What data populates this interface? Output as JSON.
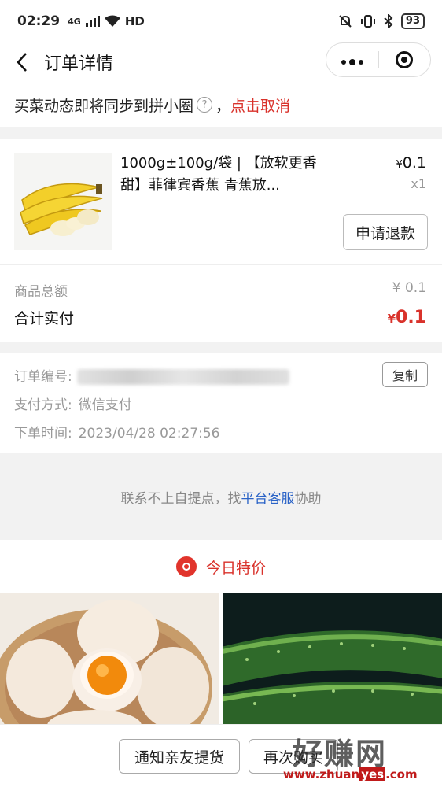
{
  "status_bar": {
    "time": "02:29",
    "network": "4G",
    "hd": "HD",
    "battery": "93"
  },
  "nav": {
    "title": "订单详情",
    "back_icon": "chevron-left-icon",
    "more_icon": "more-dots-icon",
    "close_icon": "target-close-icon"
  },
  "notice": {
    "text": "买菜动态即将同步到拼小圈",
    "comma": "，",
    "action": "点击取消"
  },
  "product": {
    "name": "1000g±100g/袋 | 【放软更香甜】菲律宾香蕉 青蕉放...",
    "price_symbol": "¥",
    "price": "0.1",
    "qty": "x1",
    "refund_label": "申请退款"
  },
  "summary": {
    "subtotal_label": "商品总额",
    "subtotal_value": "¥ 0.1",
    "total_label": "合计实付",
    "total_symbol": "¥",
    "total_value": "0.1"
  },
  "order_info": {
    "number_label": "订单编号:",
    "copy_label": "复制",
    "payment_label": "支付方式:",
    "payment_value": "微信支付",
    "time_label": "下单时间:",
    "time_value": "2023/04/28 02:27:56"
  },
  "contact": {
    "prefix": "联系不上自提点，找",
    "link": "平台客服",
    "suffix": "协助"
  },
  "specials": {
    "title": "今日特价"
  },
  "bottom": {
    "notify_label": "通知亲友提货",
    "rebuy_label": "再次购买"
  },
  "watermark": {
    "big": "好赚网",
    "url_pre": "www.zhuan",
    "url_hl": "yes",
    "url_post": ".com"
  },
  "colors": {
    "accent_red": "#d9322b",
    "link_blue": "#2a63c7"
  }
}
